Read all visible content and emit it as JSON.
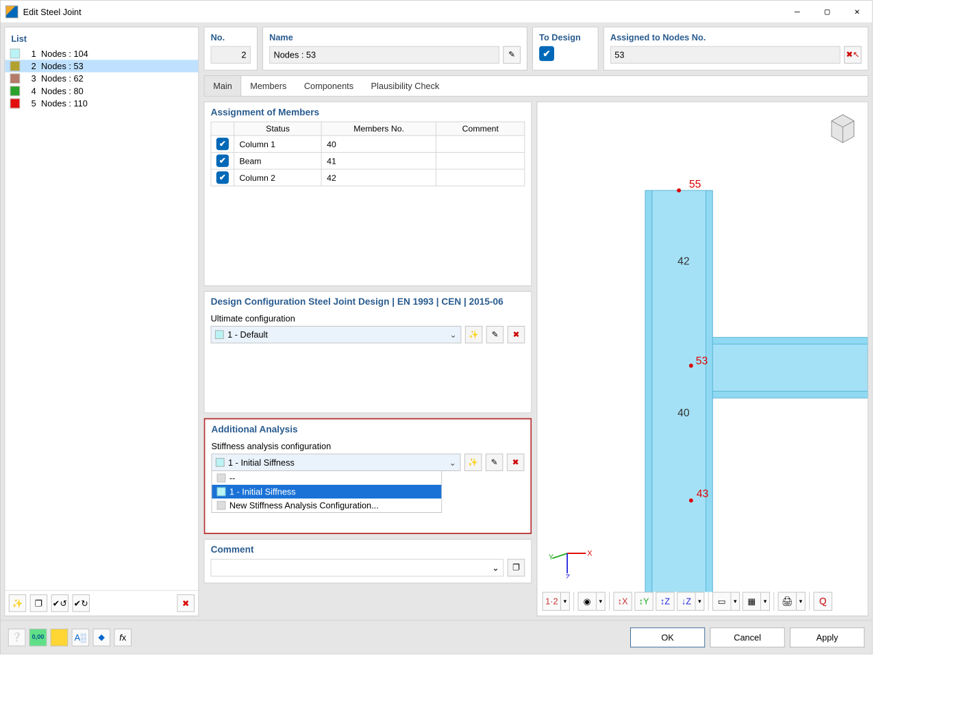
{
  "window": {
    "title": "Edit Steel Joint"
  },
  "list": {
    "title": "List",
    "items": [
      {
        "index": 1,
        "label": "Nodes : 104",
        "color": "#BAF3F5"
      },
      {
        "index": 2,
        "label": "Nodes : 53",
        "color": "#B1A12F",
        "selected": true
      },
      {
        "index": 3,
        "label": "Nodes : 62",
        "color": "#B47A6A"
      },
      {
        "index": 4,
        "label": "Nodes : 80",
        "color": "#2BA22B"
      },
      {
        "index": 5,
        "label": "Nodes : 110",
        "color": "#E30E0E"
      }
    ]
  },
  "top": {
    "no_label": "No.",
    "no_value": "2",
    "name_label": "Name",
    "name_value": "Nodes : 53",
    "to_design_label": "To Design",
    "to_design_checked": true,
    "assigned_label": "Assigned to Nodes No.",
    "assigned_value": "53"
  },
  "tabs": [
    "Main",
    "Members",
    "Components",
    "Plausibility Check"
  ],
  "active_tab": "Main",
  "assignment": {
    "title": "Assignment of Members",
    "headers": [
      "Status",
      "Members No.",
      "Comment"
    ],
    "rows": [
      {
        "status": "Column 1",
        "members_no": "40",
        "checked": true,
        "comment": ""
      },
      {
        "status": "Beam",
        "members_no": "41",
        "checked": true,
        "comment": ""
      },
      {
        "status": "Column 2",
        "members_no": "42",
        "checked": true,
        "comment": ""
      }
    ]
  },
  "design_config": {
    "title": "Design Configuration Steel Joint Design | EN 1993 | CEN | 2015-06",
    "subtitle": "Ultimate configuration",
    "value": "1 - Default"
  },
  "additional_analysis": {
    "title": "Additional Analysis",
    "subtitle": "Stiffness analysis configuration",
    "value": "1 - Initial Siffness",
    "options": [
      {
        "label": "--"
      },
      {
        "label": "1 - Initial Siffness",
        "selected": true
      },
      {
        "label": "New Stiffness Analysis Configuration..."
      }
    ]
  },
  "comment": {
    "title": "Comment",
    "value": ""
  },
  "preview": {
    "labels": {
      "top": "55",
      "mid": "53",
      "beam": "42",
      "col": "40",
      "bottom": "43"
    }
  },
  "footer": {
    "ok": "OK",
    "cancel": "Cancel",
    "apply": "Apply"
  }
}
